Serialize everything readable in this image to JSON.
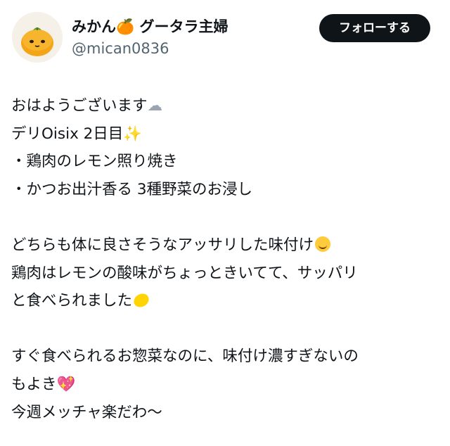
{
  "profile": {
    "display_name": "みかん",
    "display_name_emoji": "🍊",
    "display_name_suffix": "グータラ主婦",
    "handle": "@mican0836",
    "avatar_icon": "mikan-character-avatar"
  },
  "follow_button": {
    "label": "フォローする"
  },
  "post": {
    "lines": [
      {
        "text": "おはようございます",
        "emoji": "☁",
        "emoji_icon": "cloud-icon"
      },
      {
        "text": "デリOisix 2日目",
        "emoji": "✨",
        "emoji_icon": "sparkles-icon"
      },
      {
        "text": "・鶏肉のレモン照り焼き"
      },
      {
        "text": "・かつお出汁香る 3種野菜のお浸し"
      },
      {
        "text": ""
      },
      {
        "text": "どちらも体に良さそうなアッサリした味付け",
        "emoji_icon": "smiling-face-icon"
      },
      {
        "text": "鶏肉はレモンの酸味がちょっときいてて、サッパリ"
      },
      {
        "text": "と食べられました",
        "emoji_icon": "lemon-icon"
      },
      {
        "text": ""
      },
      {
        "text": "すぐ食べられるお惣菜なのに、味付け濃すぎないの"
      },
      {
        "text": "もよき",
        "emoji": "💖",
        "emoji_icon": "sparkling-heart-icon"
      },
      {
        "text": "今週メッチャ楽だわ〜"
      }
    ]
  },
  "colors": {
    "text": "#0f1419",
    "handle": "#536471",
    "button_bg": "#0f1419",
    "button_text": "#ffffff"
  }
}
